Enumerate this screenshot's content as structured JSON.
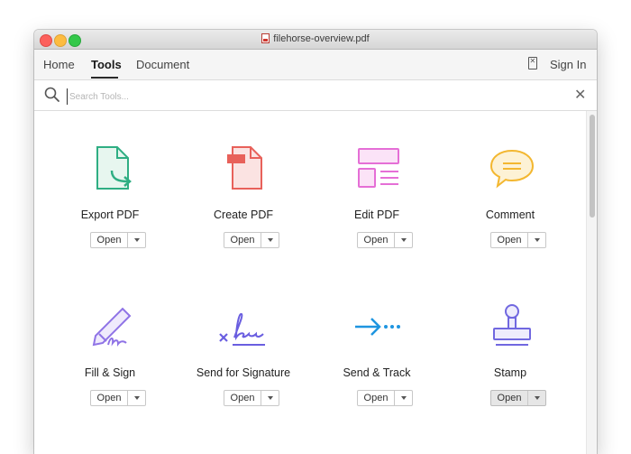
{
  "window": {
    "title": "filehorse-overview.pdf",
    "file_icon": "pdf-file-icon"
  },
  "toolbar": {
    "tabs": [
      {
        "label": "Home"
      },
      {
        "label": "Tools",
        "active": true
      },
      {
        "label": "Document"
      }
    ],
    "sign_in": "Sign In"
  },
  "search": {
    "placeholder": "Search Tools...",
    "value": ""
  },
  "tools": [
    {
      "label": "Export PDF",
      "icon": "export-pdf-icon",
      "button": "Open"
    },
    {
      "label": "Create PDF",
      "icon": "create-pdf-icon",
      "button": "Open"
    },
    {
      "label": "Edit PDF",
      "icon": "edit-pdf-icon",
      "button": "Open"
    },
    {
      "label": "Comment",
      "icon": "comment-icon",
      "button": "Open"
    },
    {
      "label": "Fill & Sign",
      "icon": "fill-sign-icon",
      "button": "Open"
    },
    {
      "label": "Send for Signature",
      "icon": "send-for-signature-icon",
      "button": "Open"
    },
    {
      "label": "Send & Track",
      "icon": "send-track-icon",
      "button": "Open"
    },
    {
      "label": "Stamp",
      "icon": "stamp-icon",
      "button": "Open"
    }
  ],
  "colors": {
    "export": "#2fae83",
    "create": "#e8615a",
    "edit": "#e56fd6",
    "comment": "#f3b730",
    "fill_sign": "#8f73e6",
    "signature": "#6a5ee0",
    "send_track": "#1e95e0",
    "stamp": "#7168e0"
  }
}
